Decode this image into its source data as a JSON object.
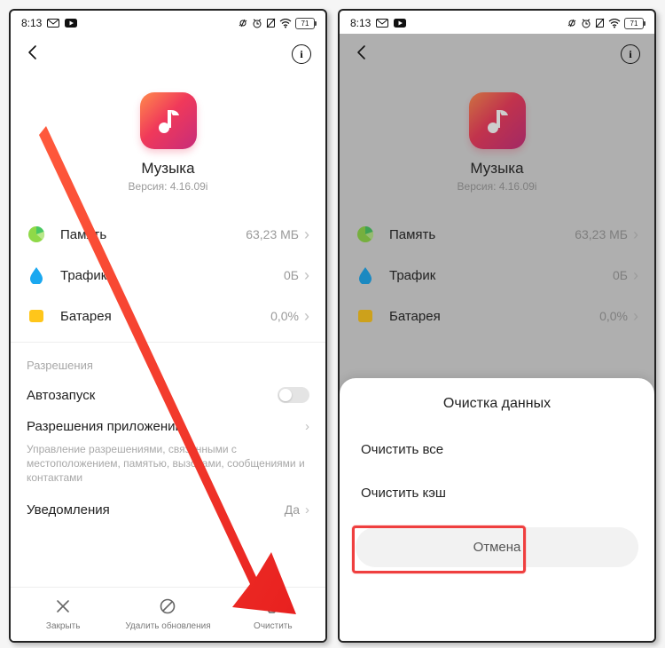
{
  "status": {
    "time": "8:13",
    "battery": "71"
  },
  "app": {
    "name": "Музыка",
    "version": "Версия: 4.16.09i"
  },
  "rows": {
    "memory": {
      "label": "Память",
      "value": "63,23 МБ"
    },
    "traffic": {
      "label": "Трафик",
      "value": "0Б"
    },
    "battery": {
      "label": "Батарея",
      "value": "0,0%"
    }
  },
  "permissions": {
    "section": "Разрешения",
    "autostart": "Автозапуск",
    "app_perms": "Разрешения приложений",
    "app_perms_desc": "Управление разрешениями, связанными с местоположением, памятью, вызовами, сообщениями и контактами",
    "notifications": {
      "label": "Уведомления",
      "value": "Да"
    }
  },
  "bottom": {
    "close": "Закрыть",
    "uninstall_updates": "Удалить обновления",
    "clear": "Очистить"
  },
  "sheet": {
    "title": "Очистка данных",
    "clear_all": "Очистить все",
    "clear_cache": "Очистить кэш",
    "cancel": "Отмена"
  }
}
